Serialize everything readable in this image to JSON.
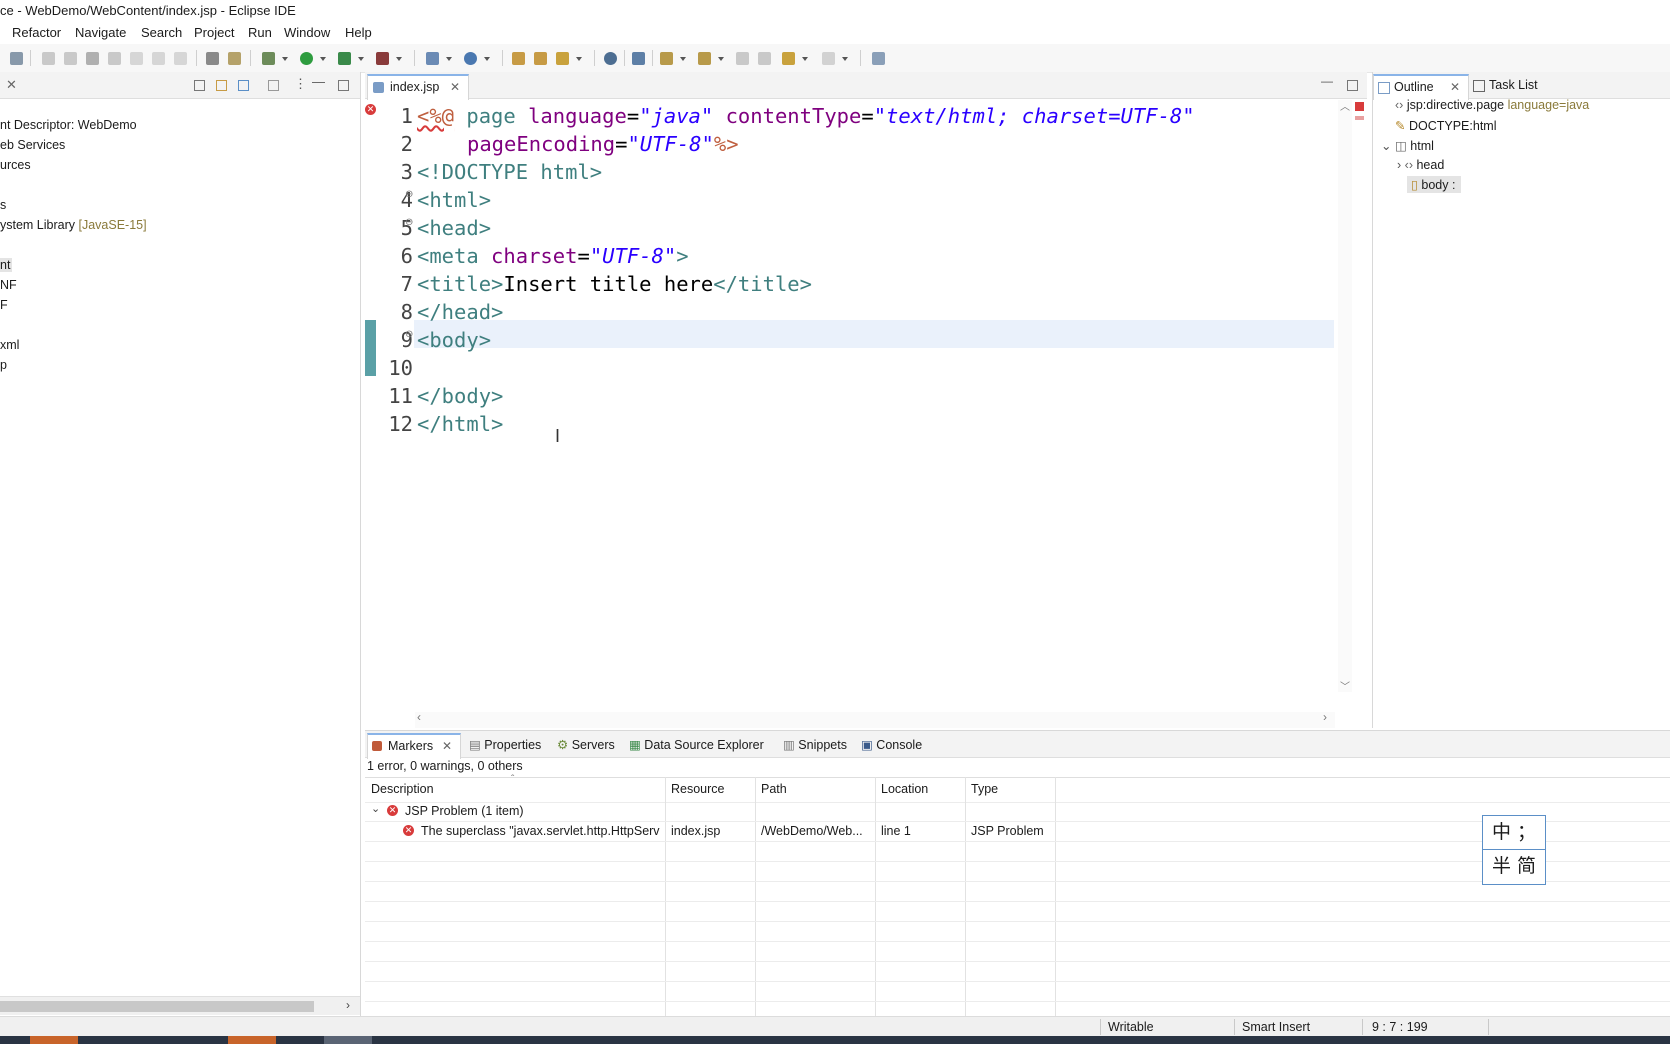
{
  "window": {
    "title": "ce - WebDemo/WebContent/index.jsp - Eclipse IDE"
  },
  "menu": [
    "Refactor",
    "Navigate",
    "Search",
    "Project",
    "Run",
    "Window",
    "Help"
  ],
  "explorer": {
    "items": [
      {
        "label": "nt Descriptor: WebDemo",
        "suffix": ""
      },
      {
        "label": "eb Services",
        "suffix": ""
      },
      {
        "label": "urces",
        "suffix": ""
      },
      {
        "label": "s",
        "suffix": ""
      },
      {
        "label": "ystem Library ",
        "suffix": "[JavaSE-15]"
      },
      {
        "label": "nt",
        "suffix": ""
      },
      {
        "label": "NF",
        "suffix": ""
      },
      {
        "label": "F",
        "suffix": ""
      },
      {
        "label": "xml",
        "suffix": ""
      },
      {
        "label": "p",
        "suffix": ""
      }
    ]
  },
  "editor": {
    "tab_label": "index.jsp",
    "line_numbers": [
      "1",
      "2",
      "3",
      "4",
      "5",
      "6",
      "7",
      "8",
      "9",
      "10",
      "11",
      "12"
    ],
    "code": {
      "l1_open": "<%@",
      "l1_page": " page ",
      "l1_attr1": "language",
      "l1_eq": "=",
      "l1_val1": "\"java\"",
      "l1_attr2": " contentType",
      "l1_val2": "\"text/html; charset=UTF-8\"",
      "l2_attr": "pageEncoding",
      "l2_val": "\"UTF-8\"",
      "l2_close": "%>",
      "l3": "<!DOCTYPE html>",
      "l4": "<html>",
      "l5": "<head>",
      "l6_tag": "<meta",
      "l6_attr": " charset",
      "l6_val": "\"UTF-8\"",
      "l6_close": ">",
      "l7_open": "<title>",
      "l7_text": "Insert title here",
      "l7_close": "</title>",
      "l8": "</head>",
      "l9": "<body>",
      "l11": "</body>",
      "l12": "</html>"
    }
  },
  "outline": {
    "tabs": [
      "Outline",
      "Task List"
    ],
    "items": [
      {
        "label": "jsp:directive.page ",
        "suffix": "language=java"
      },
      {
        "label": "DOCTYPE:html",
        "suffix": ""
      },
      {
        "label": "html",
        "suffix": ""
      },
      {
        "label": "head",
        "suffix": ""
      },
      {
        "label": "body :",
        "suffix": ""
      }
    ]
  },
  "markers": {
    "tabs": [
      "Markers",
      "Properties",
      "Servers",
      "Data Source Explorer",
      "Snippets",
      "Console"
    ],
    "summary": "1 error, 0 warnings, 0 others",
    "columns": [
      "Description",
      "Resource",
      "Path",
      "Location",
      "Type"
    ],
    "group": "JSP Problem (1 item)",
    "row": {
      "description": "The superclass \"javax.servlet.http.HttpServ",
      "resource": "index.jsp",
      "path": "/WebDemo/Web...",
      "location": "line 1",
      "type": "JSP Problem"
    }
  },
  "status": {
    "writable": "Writable",
    "insert_mode": "Smart Insert",
    "position": "9 : 7 : 199"
  },
  "ime": {
    "row1": "中 ；",
    "row2": "半 简"
  },
  "colors": {
    "accent": "#8ab4e8",
    "error": "#d83b3b",
    "current_line": "#eaf1fb"
  }
}
